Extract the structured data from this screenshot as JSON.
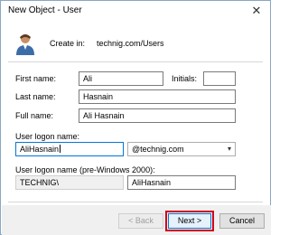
{
  "window": {
    "title": "New Object - User",
    "close_glyph": "✕"
  },
  "header": {
    "create_in_label": "Create in:",
    "create_in_value": "technig.com/Users",
    "icon": "user-icon"
  },
  "form": {
    "first_name_label": "First name:",
    "first_name_value": "Ali",
    "initials_label": "Initials:",
    "initials_value": "",
    "last_name_label": "Last name:",
    "last_name_value": "Hasnain",
    "full_name_label": "Full name:",
    "full_name_value": "Ali Hasnain",
    "logon_label": "User logon name:",
    "logon_value": "AliHasnain",
    "domain_value": "@technig.com",
    "pre2000_label": "User logon name (pre-Windows 2000):",
    "pre2000_domain": "TECHNIG\\",
    "pre2000_value": "AliHasnain"
  },
  "buttons": {
    "back": "< Back",
    "next": "Next >",
    "cancel": "Cancel"
  },
  "colors": {
    "accent": "#0078d7",
    "highlight": "#d0021b",
    "footer_bg": "#f0f0f0"
  }
}
